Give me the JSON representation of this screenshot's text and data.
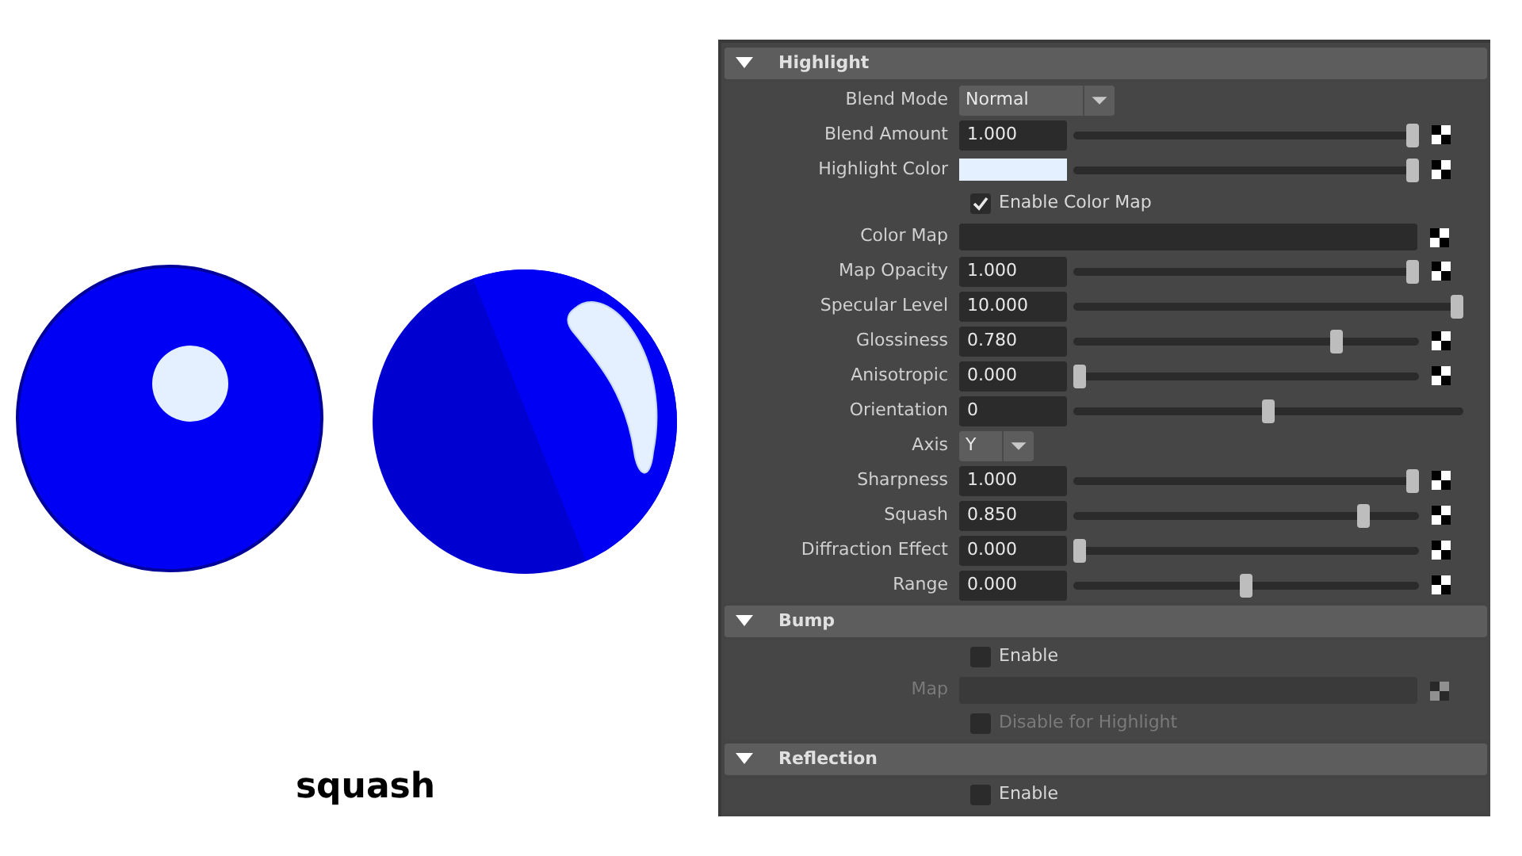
{
  "caption": "squash",
  "sections": [
    {
      "title": "Highlight",
      "expanded": true,
      "rows": [
        {
          "kind": "dropdown",
          "label": "Blend Mode",
          "value": "Normal"
        },
        {
          "kind": "slider",
          "label": "Blend Amount",
          "value": "1.000",
          "level": 1,
          "map_button": true
        },
        {
          "kind": "color",
          "label": "Highlight Color",
          "color": "#e4f0ff",
          "level": 1,
          "map_button": true
        },
        {
          "kind": "checkbox",
          "label": "Enable Color Map",
          "checked": true,
          "disabled": false
        },
        {
          "kind": "map",
          "label": "Color Map",
          "disabled": false
        },
        {
          "kind": "slider",
          "label": "Map Opacity",
          "value": "1.000",
          "level": 1,
          "map_button": true
        },
        {
          "kind": "slider",
          "label": "Specular Level",
          "value": "10.000",
          "level": 1,
          "map_button": false
        },
        {
          "kind": "slider",
          "label": "Glossiness",
          "value": "0.780",
          "level": 0.77,
          "map_button": true
        },
        {
          "kind": "slider",
          "label": "Anisotropic",
          "value": "0.000",
          "level": 0,
          "map_button": true
        },
        {
          "kind": "slider",
          "label": "Orientation",
          "value": "0",
          "level": 0.5,
          "map_button": false
        },
        {
          "kind": "dropdown",
          "label": "Axis",
          "value": "Y"
        },
        {
          "kind": "slider",
          "label": "Sharpness",
          "value": "1.000",
          "level": 1,
          "map_button": true
        },
        {
          "kind": "slider",
          "label": "Squash",
          "value": "0.850",
          "level": 0.85,
          "map_button": true
        },
        {
          "kind": "slider",
          "label": "Diffraction Effect",
          "value": "0.000",
          "level": 0,
          "map_button": true
        },
        {
          "kind": "slider",
          "label": "Range",
          "value": "0.000",
          "level": 0.5,
          "map_button": true
        }
      ]
    },
    {
      "title": "Bump",
      "expanded": true,
      "rows": [
        {
          "kind": "checkbox",
          "label": "Enable",
          "checked": false,
          "disabled": false
        },
        {
          "kind": "map",
          "label": "Map",
          "disabled": true
        },
        {
          "kind": "checkbox",
          "label": "Disable for Highlight",
          "checked": false,
          "disabled": true
        }
      ]
    },
    {
      "title": "Reflection",
      "expanded": true,
      "rows": [
        {
          "kind": "checkbox",
          "label": "Enable",
          "checked": false,
          "disabled": false
        }
      ]
    }
  ]
}
